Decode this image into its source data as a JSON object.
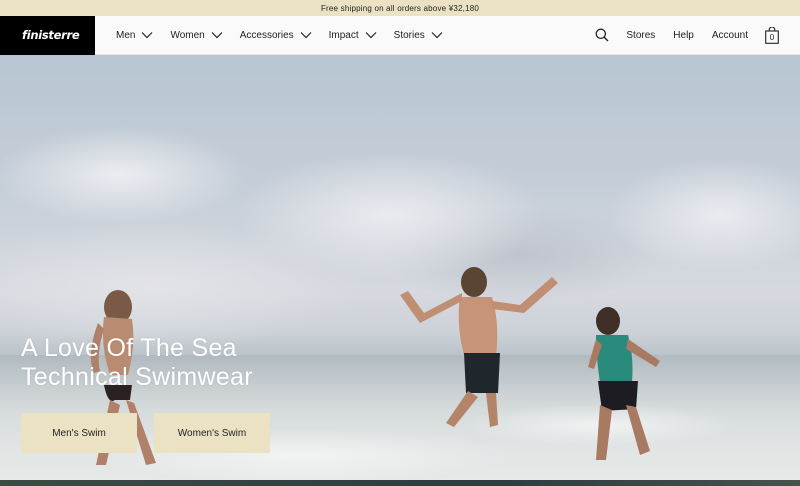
{
  "promo": {
    "text": "Free shipping on all orders above ¥32,180"
  },
  "brand": {
    "logo_text": "finisterre"
  },
  "nav": {
    "menu": [
      {
        "label": "Men"
      },
      {
        "label": "Women"
      },
      {
        "label": "Accessories"
      },
      {
        "label": "Impact"
      },
      {
        "label": "Stories"
      }
    ],
    "links": {
      "stores": "Stores",
      "help": "Help",
      "account": "Account"
    },
    "bag_count": "0",
    "icons": [
      "search-icon",
      "chevron-down-icon",
      "bag-icon"
    ]
  },
  "hero": {
    "headline_line1": "A Love Of The Sea",
    "headline_line2": "Technical Swimwear",
    "cta_men": "Men's Swim",
    "cta_women": "Women's Swim"
  },
  "colors": {
    "promo_bg": "#ebe2c4",
    "logo_bg": "#000000",
    "button_bg": "#ebe2c4",
    "headline": "#ffffff"
  }
}
